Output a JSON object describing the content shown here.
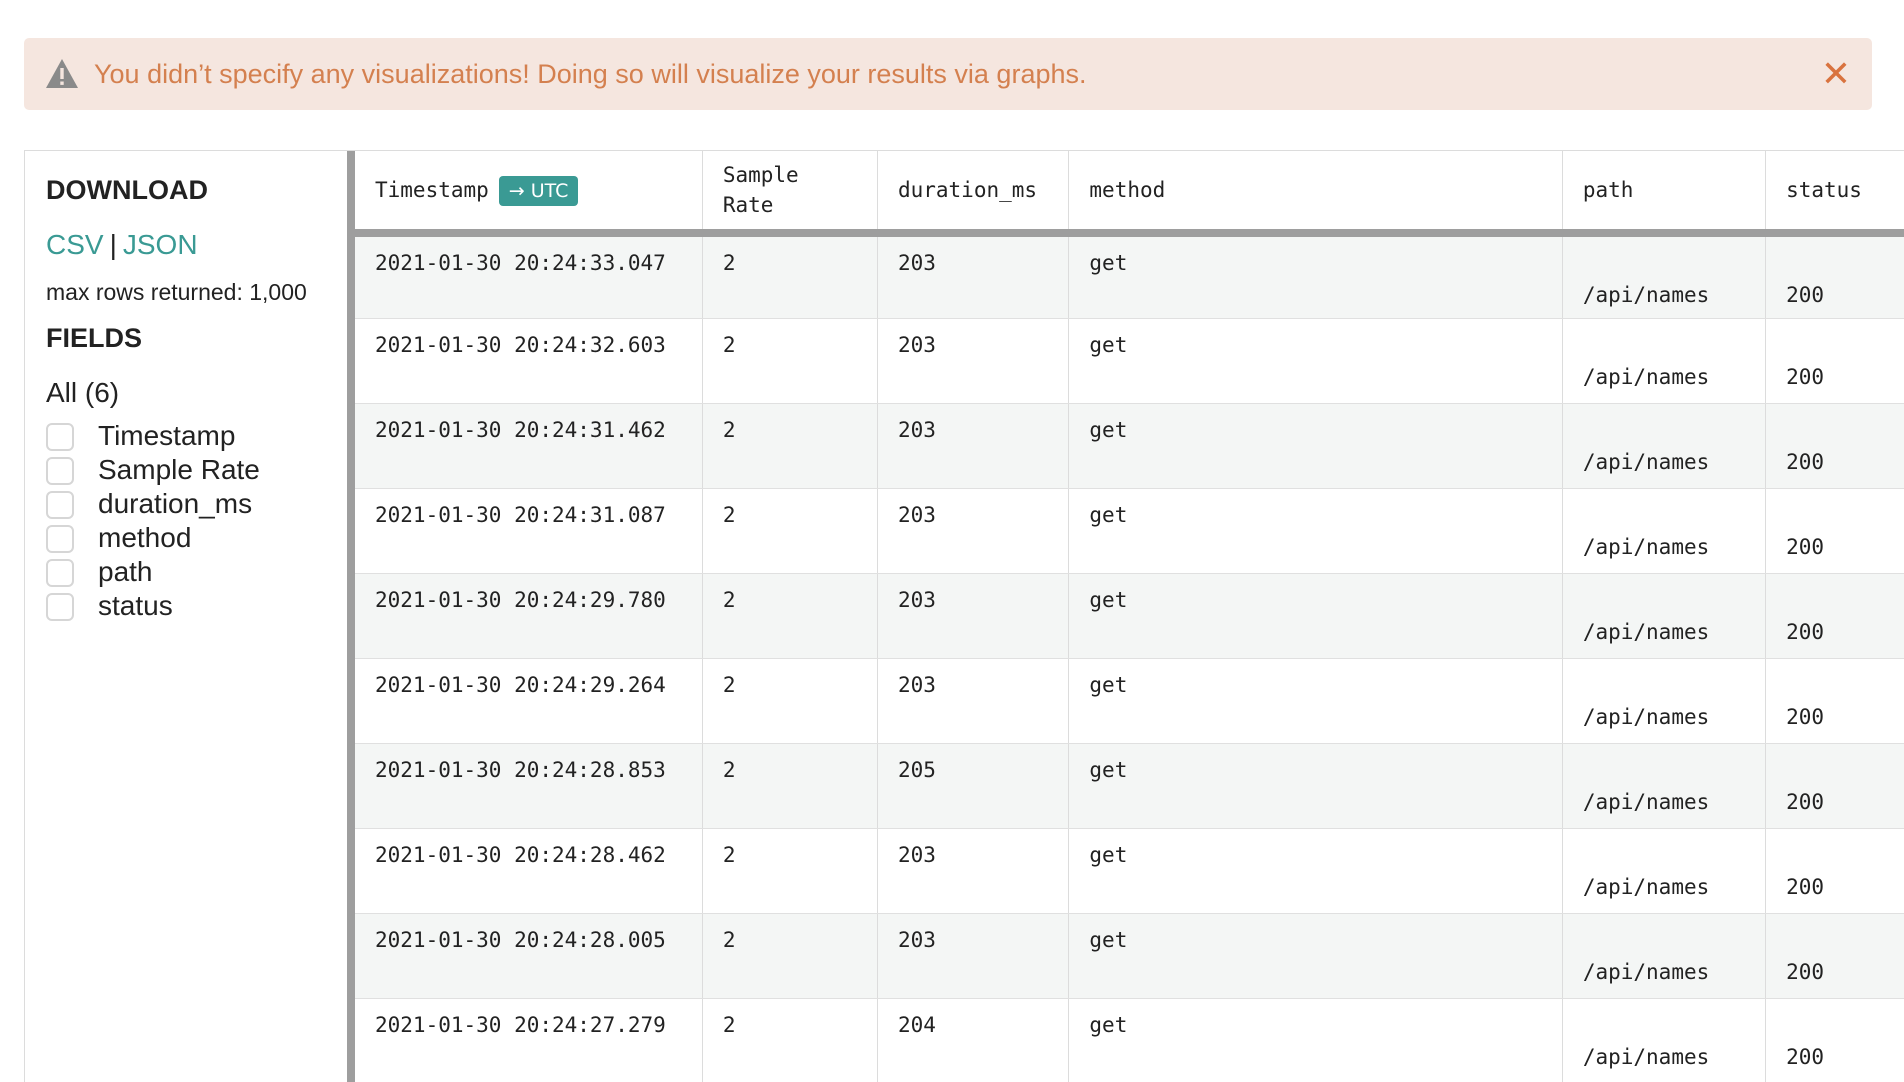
{
  "banner": {
    "message": "You didn’t specify any visualizations! Doing so will visualize your results via graphs.",
    "close_glyph": "✕",
    "color": "#d4804f",
    "background": "#f5e6df"
  },
  "sidebar": {
    "download_heading": "DOWNLOAD",
    "csv_label": "CSV",
    "separator": "|",
    "json_label": "JSON",
    "max_rows": "max rows returned: 1,000",
    "fields_heading": "FIELDS",
    "all_label": "All (6)",
    "fields": [
      "Timestamp",
      "Sample Rate",
      "duration_ms",
      "method",
      "path",
      "status"
    ]
  },
  "table": {
    "columns": {
      "timestamp": "Timestamp",
      "utc_badge": "→ UTC",
      "sample_rate_1": "Sample",
      "sample_rate_2": "Rate",
      "duration": "duration_ms",
      "method": "method",
      "path": "path",
      "status": "status"
    },
    "rows": [
      [
        "2021-01-30 20:24:33.047",
        "2",
        "203",
        "get",
        "/api/names",
        "200"
      ],
      [
        "2021-01-30 20:24:32.603",
        "2",
        "203",
        "get",
        "/api/names",
        "200"
      ],
      [
        "2021-01-30 20:24:31.462",
        "2",
        "203",
        "get",
        "/api/names",
        "200"
      ],
      [
        "2021-01-30 20:24:31.087",
        "2",
        "203",
        "get",
        "/api/names",
        "200"
      ],
      [
        "2021-01-30 20:24:29.780",
        "2",
        "203",
        "get",
        "/api/names",
        "200"
      ],
      [
        "2021-01-30 20:24:29.264",
        "2",
        "203",
        "get",
        "/api/names",
        "200"
      ],
      [
        "2021-01-30 20:24:28.853",
        "2",
        "205",
        "get",
        "/api/names",
        "200"
      ],
      [
        "2021-01-30 20:24:28.462",
        "2",
        "203",
        "get",
        "/api/names",
        "200"
      ],
      [
        "2021-01-30 20:24:28.005",
        "2",
        "203",
        "get",
        "/api/names",
        "200"
      ],
      [
        "2021-01-30 20:24:27.279",
        "2",
        "204",
        "get",
        "/api/names",
        "200"
      ]
    ]
  },
  "colors": {
    "accent": "#3a9a94",
    "divider": "#9e9e9e"
  },
  "icons": {
    "banner": "warning-icon",
    "close": "close-icon"
  }
}
